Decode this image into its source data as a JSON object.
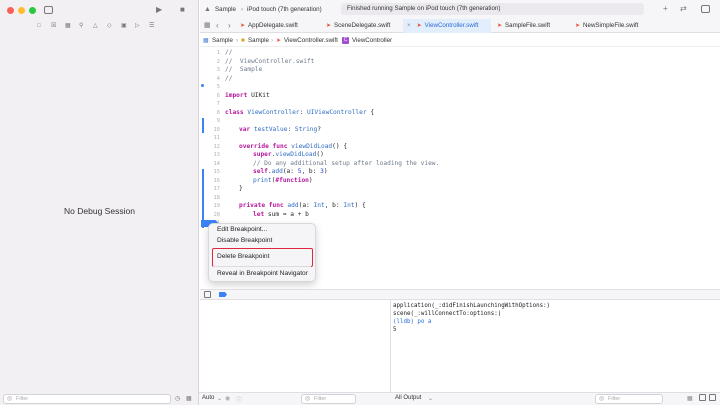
{
  "window": {
    "traffic_lights": [
      "close",
      "minimize",
      "zoom"
    ]
  },
  "left_panel": {
    "no_debug_session": "No Debug Session",
    "filter_placeholder": "Filter"
  },
  "toolbar": {
    "scheme": "Sample",
    "device": "iPod touch (7th generation)",
    "status": "Finished running Sample on iPod touch (7th generation)",
    "run_icon": "play-icon",
    "stop_icon": "stop-icon"
  },
  "tabs": [
    {
      "label": "AppDelegate.swift"
    },
    {
      "label": "SceneDelegate.swift"
    },
    {
      "label": "ViewController.swift",
      "active": true
    },
    {
      "label": "SampleFile.swift"
    },
    {
      "label": "NewSimpleFile.swift"
    }
  ],
  "breadcrumb": [
    "Sample",
    "Sample",
    "ViewController.swift",
    "ViewController"
  ],
  "line_numbers": [
    "1",
    "2",
    "3",
    "4",
    "5",
    "6",
    "7",
    "8",
    "9",
    "10",
    "11",
    "12",
    "13",
    "14",
    "15",
    "16",
    "17",
    "18",
    "19",
    "20",
    "21",
    "22"
  ],
  "code": {
    "l1": "//",
    "l2": "//  ViewController.swift",
    "l3": "//  Sample",
    "l4": "//",
    "l6a": "import",
    "l6b": " UIKit",
    "l8a": "class",
    "l8b": " ViewController",
    "l8c": ": ",
    "l8d": "UIViewController",
    "l8e": " {",
    "l10a": "var",
    "l10b": " testValue",
    "l10c": ": ",
    "l10d": "String",
    "l10e": "?",
    "l12a": "override func",
    "l12b": " viewDidLoad",
    "l12c": "() {",
    "l13a": "super",
    "l13b": ".",
    "l13c": "viewDidLoad",
    "l13d": "()",
    "l14": "// Do any additional setup after loading the view.",
    "l15a": "self",
    "l15b": ".",
    "l15c": "add",
    "l15d": "(a: ",
    "l15e": "5",
    "l15f": ", b: ",
    "l15g": "3",
    "l15h": ")",
    "l16a": "print",
    "l16b": "(",
    "l16c": "#function",
    "l16d": ")",
    "l17": "}",
    "l19a": "private func",
    "l19b": " add",
    "l19c": "(a: ",
    "l19d": "Int",
    "l19e": ", b: ",
    "l19f": "Int",
    "l19g": ") {",
    "l20a": "let",
    "l20b": " sum = a + b"
  },
  "context_menu": {
    "items": [
      "Edit Breakpoint...",
      "Disable Breakpoint",
      "Delete Breakpoint",
      "Reveal in Breakpoint Navigator"
    ],
    "highlighted": "Delete Breakpoint"
  },
  "console": {
    "lines": [
      "application(_:didFinishLaunchingWithOptions:)",
      "scene(_:willConnectTo:options:)",
      "(lldb) po a",
      "5"
    ]
  },
  "bottom": {
    "auto_label": "Auto",
    "variables_filter": "Filter",
    "output_selector": "All Output",
    "console_filter": "Filter"
  },
  "colors": {
    "accent": "#2a6ad9",
    "highlight_border": "#e0263f",
    "breakpoint": "#3b82f6"
  }
}
